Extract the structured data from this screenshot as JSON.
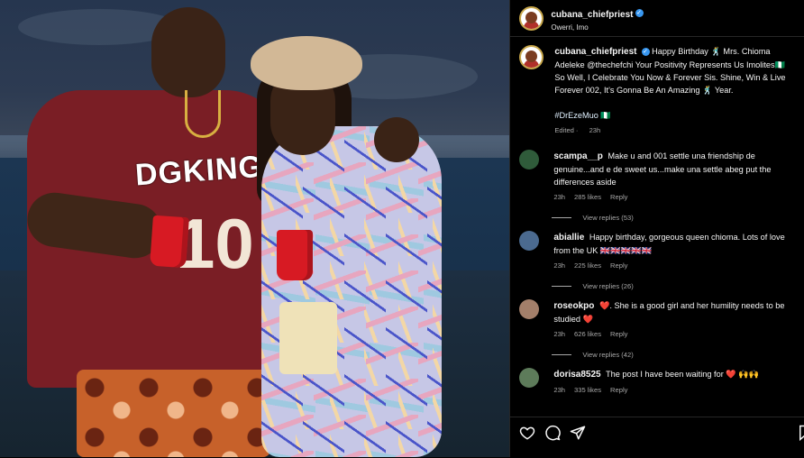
{
  "post": {
    "username": "cubana_chiefpriest",
    "location": "Owerri, Imo",
    "caption": {
      "username": "cubana_chiefpriest",
      "text": "Happy Birthday 🕺 Mrs. Chioma Adeleke @thechefchi Your Positivity Represents Us Imolites🇳🇬 So Well, I Celebrate You Now & Forever Sis. Shine, Win & Live Forever 002, It's Gonna Be An Amazing 🕺 Year.",
      "hashtag": "#DrEzeMuo 🇳🇬",
      "edited": "Edited",
      "time": "23h"
    },
    "photo": {
      "jersey_text": "DGKING",
      "jersey_number": "10"
    }
  },
  "comments": [
    {
      "username": "scampa__p",
      "text": "Make u and 001 settle una friendship de genuine...and e de sweet us...make una settle abeg put the differences aside",
      "time": "23h",
      "likes": "285 likes",
      "reply": "Reply",
      "view_replies": "View replies (53)",
      "avatar_color": "#2f5b3a"
    },
    {
      "username": "abiallie",
      "text": "Happy birthday, gorgeous queen chioma. Lots of love from the UK 🇬🇧🇬🇧🇬🇧🇬🇧🇬🇧",
      "time": "23h",
      "likes": "225 likes",
      "reply": "Reply",
      "view_replies": "View replies (26)",
      "avatar_color": "#4b6a8f"
    },
    {
      "username": "roseokpo",
      "text": "❤️. She is a good girl and her humility needs to be studied ❤️",
      "time": "23h",
      "likes": "626 likes",
      "reply": "Reply",
      "view_replies": "View replies (42)",
      "avatar_color": "#a37f6a"
    },
    {
      "username": "dorisa8525",
      "text": "The post I have been waiting for ❤️ 🙌🙌",
      "time": "23h",
      "likes": "335 likes",
      "reply": "Reply",
      "view_replies": "",
      "avatar_color": "#5d7b5a"
    }
  ],
  "actions": {
    "like_icon": "heart-outline-icon",
    "comment_icon": "comment-bubble-icon",
    "share_icon": "paper-plane-icon",
    "save_icon": "bookmark-icon"
  },
  "colors": {
    "background": "#000000",
    "text": "#f5f5f5",
    "secondary_text": "#a8a8a8",
    "verified": "#3897f0",
    "divider": "#262626"
  }
}
